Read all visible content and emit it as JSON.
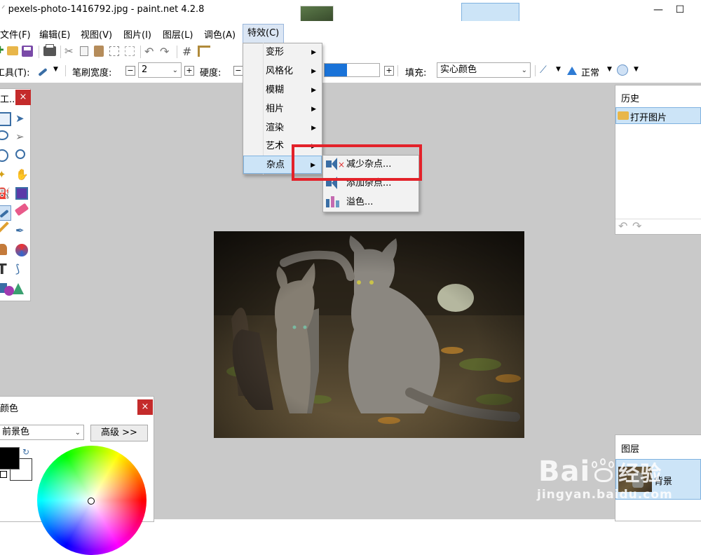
{
  "window": {
    "title": "pexels-photo-1416792.jpg - paint.net 4.2.8",
    "minimize": "—",
    "maximize": "☐"
  },
  "menu": [
    "文件(F)",
    "编辑(E)",
    "视图(V)",
    "图片(I)",
    "图层(L)",
    "调色(A)",
    "特效(C)"
  ],
  "menu_active": "特效(C)",
  "toolbar": {
    "tool_label": "工具(T):",
    "brush_width_label": "笔刷宽度:",
    "brush_width_value": "2",
    "hardness_label": "硬度:",
    "fill_label": "填充:",
    "fill_value": "实心颜色",
    "blend_value": "正常",
    "minus": "−",
    "plus": "+"
  },
  "effects_menu": {
    "items": [
      "变形",
      "风格化",
      "模糊",
      "相片",
      "渲染",
      "艺术",
      "杂点"
    ],
    "highlighted": "杂点"
  },
  "noise_submenu": {
    "items": [
      "减少杂点...",
      "添加杂点...",
      "溢色..."
    ]
  },
  "tools_panel": {
    "title": "工...",
    "close": "×"
  },
  "history_panel": {
    "title": "历史",
    "items": [
      "打开图片"
    ]
  },
  "layers_panel": {
    "title": "图层",
    "items": [
      "背景"
    ]
  },
  "colors_panel": {
    "title": "颜色",
    "close": "×",
    "color_select": "前景色",
    "advanced_button": "高级 >>"
  },
  "watermark": {
    "brand": "Bai",
    "brand_tail": "经验",
    "url": "jingyan.baidu.com"
  },
  "colors": {
    "highlight_red": "#e3222a",
    "canvas_bg": "#c9c9c9",
    "menu_hover": "#dbe6f4",
    "selection_blue": "#cce4f7"
  }
}
